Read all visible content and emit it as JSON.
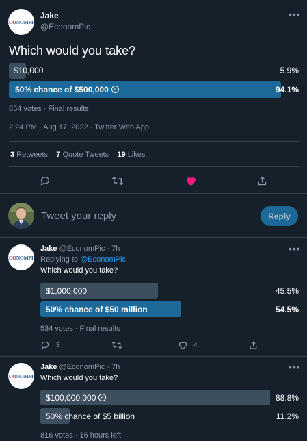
{
  "main_tweet": {
    "name": "Jake",
    "handle": "@EconomPic",
    "text": "Which would you take?",
    "poll": [
      {
        "label": "$10,000",
        "percent_text": "5.9%",
        "percent": 5.9,
        "winner": false
      },
      {
        "label": "50% chance of $500,000",
        "percent_text": "94.1%",
        "percent": 94.1,
        "winner": true
      }
    ],
    "poll_meta": "854 votes · Final results",
    "timestamp": "2:24 PM · Aug 17, 2022 · Twitter Web App",
    "stats": {
      "retweets_num": "3",
      "retweets_label": "Retweets",
      "quotes_num": "7",
      "quotes_label": "Quote Tweets",
      "likes_num": "19",
      "likes_label": "Likes"
    },
    "liked": true
  },
  "reply_box": {
    "placeholder": "Tweet your reply",
    "button": "Reply"
  },
  "reply1": {
    "name": "Jake",
    "handle_time": "@EconomPic · 7h",
    "replying_prefix": "Replying to ",
    "replying_handle": "@EconomPic",
    "text": "Which would you take?",
    "poll": [
      {
        "label": "$1,000,000",
        "percent_text": "45.5%",
        "percent": 45.5,
        "winner": false
      },
      {
        "label": "50% chance of $50 million",
        "percent_text": "54.5%",
        "percent": 54.5,
        "winner": true
      }
    ],
    "poll_meta": "534 votes · Final results",
    "reply_count": "3",
    "like_count": "4"
  },
  "reply2": {
    "name": "Jake",
    "handle_time": "@EconomPic · 7h",
    "text": "Which would you take?",
    "poll": [
      {
        "label": "$100,000,000",
        "percent_text": "88.8%",
        "percent": 88.8,
        "winner": false,
        "selected": true
      },
      {
        "label": "50% chance of $5 billion",
        "percent_text": "11.2%",
        "percent": 11.2,
        "winner": false
      }
    ],
    "poll_meta": "816 votes · 16 hours left"
  },
  "logo": {
    "part1": "EC",
    "part2": "NOMPIC"
  },
  "colors": {
    "background": "#15202b",
    "winner_bar": "#1d6a9a",
    "loser_bar": "#3d4e5f",
    "like_pink": "#f91880",
    "link_blue": "#1d9bf0",
    "divider": "#38444d"
  }
}
